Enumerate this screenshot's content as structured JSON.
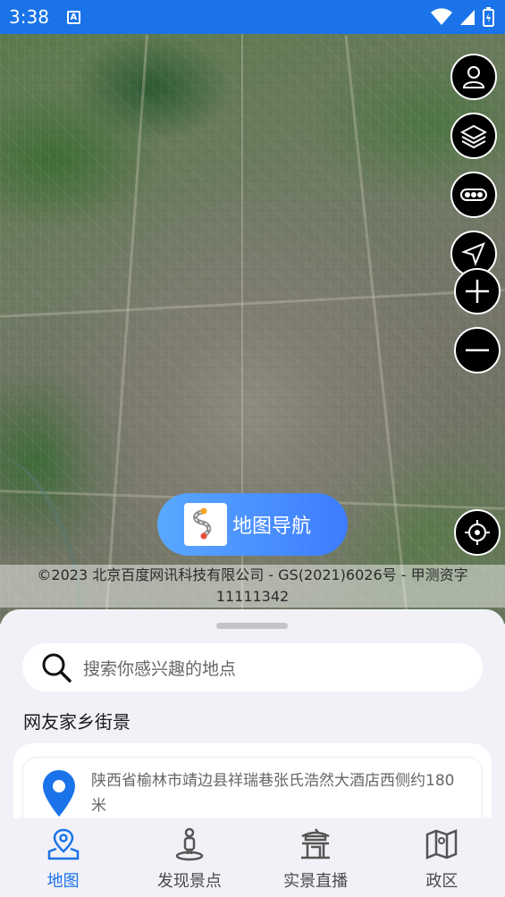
{
  "status_bar": {
    "time": "3:38",
    "notification_icon": "A"
  },
  "map": {
    "nav_button_label": "地图导航",
    "copyright_line1": "©2023 北京百度网讯科技有限公司 - GS(2021)6026号 - 甲测资字",
    "copyright_line2": "11111342",
    "controls": [
      "user-icon",
      "layers-icon",
      "traffic-icon",
      "compass-icon",
      "zoom-in-icon",
      "zoom-out-icon",
      "locate-icon"
    ]
  },
  "sheet": {
    "search_placeholder": "搜索你感兴趣的地点",
    "section_title": "网友家乡街景",
    "card": {
      "address": "陕西省榆林市靖边县祥瑞巷张氏浩然大酒店西侧约180米"
    }
  },
  "bottom_nav": {
    "items": [
      {
        "label": "地图",
        "icon": "map-pin-icon",
        "active": true
      },
      {
        "label": "发现景点",
        "icon": "person-icon",
        "active": false
      },
      {
        "label": "实景直播",
        "icon": "pavilion-icon",
        "active": false
      },
      {
        "label": "政区",
        "icon": "region-map-icon",
        "active": false
      }
    ]
  },
  "colors": {
    "accent": "#1a73e8",
    "pill_start": "#5aa8ff",
    "pill_end": "#3d7cff"
  }
}
